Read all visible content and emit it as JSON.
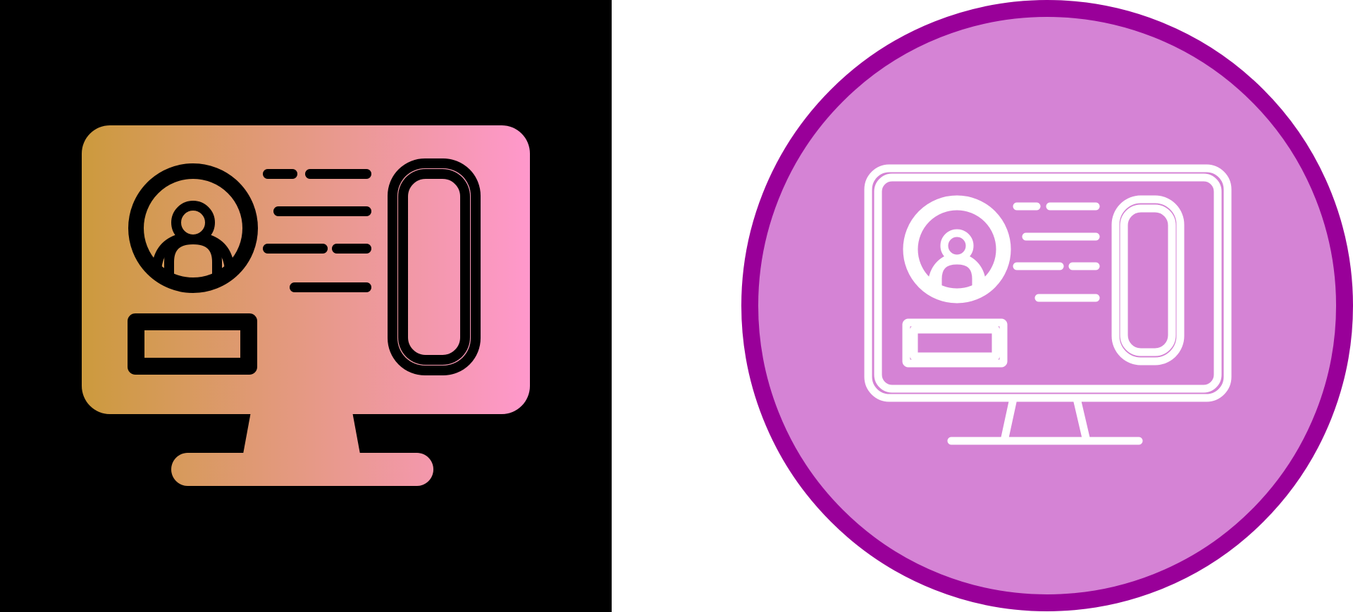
{
  "icons": [
    {
      "variant": "gradient-glyph",
      "icon": "computer-profile-icon",
      "background": "#000000",
      "gradient_start": "#CC9A3D",
      "gradient_end": "#FF98CC",
      "stroke": "#000000"
    },
    {
      "variant": "outline-circle",
      "icon": "computer-profile-icon",
      "background": "#FFFFFF",
      "circle_fill": "#D583D5",
      "circle_border": "#990099",
      "stroke": "#FFFFFF"
    }
  ]
}
